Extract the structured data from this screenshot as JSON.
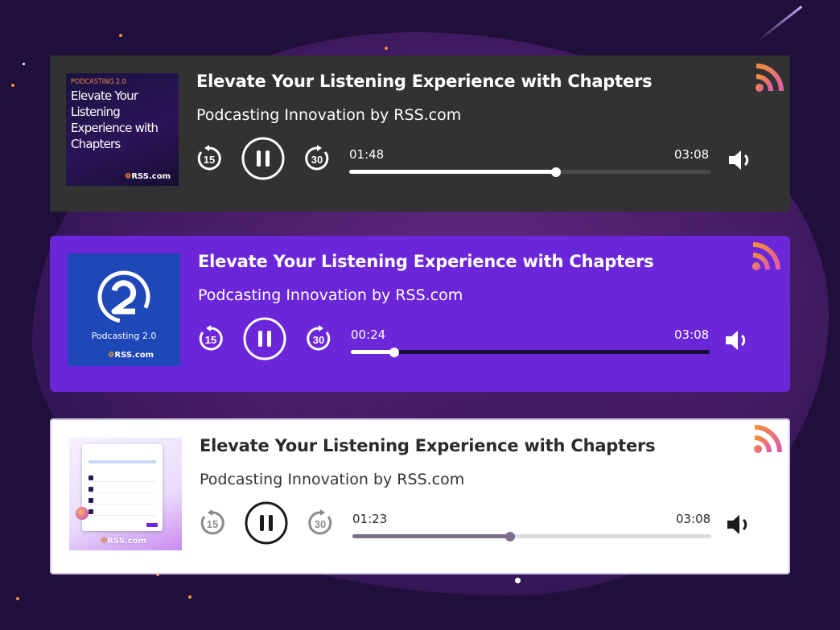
{
  "theme": {
    "accent_orange": "#f3903a",
    "dark_bg": "#323232",
    "purple_bg": "#6b26d9",
    "white_bg": "#ffffff",
    "page_bg": "#1f0f3a"
  },
  "players": [
    {
      "variant": "dark",
      "episode_title": "Elevate Your Listening Experience with Chapters",
      "show_name": "Podcasting Innovation by RSS.com",
      "current_time": "01:48",
      "duration": "03:08",
      "progress_fraction": 0.57,
      "skip_back_seconds": "15",
      "skip_forward_seconds": "30",
      "cover": {
        "tag": "PODCASTING 2.0",
        "headline": "Elevate Your Listening Experience with Chapters",
        "brand_prefix": "❁",
        "brand": "RSS.com"
      },
      "icons": [
        "rss-feed-icon",
        "skip-back-15-icon",
        "pause-icon",
        "skip-forward-30-icon",
        "volume-icon"
      ]
    },
    {
      "variant": "purple",
      "episode_title": "Elevate Your Listening Experience with Chapters",
      "show_name": "Podcasting Innovation by RSS.com",
      "current_time": "00:24",
      "duration": "03:08",
      "progress_fraction": 0.12,
      "skip_back_seconds": "15",
      "skip_forward_seconds": "30",
      "cover": {
        "name": "Podcasting 2.0",
        "brand": "RSS.com"
      },
      "icons": [
        "rss-feed-icon",
        "skip-back-15-icon",
        "pause-icon",
        "skip-forward-30-icon",
        "volume-icon"
      ]
    },
    {
      "variant": "white",
      "episode_title": "Elevate Your Listening Experience with Chapters",
      "show_name": "Podcasting Innovation by RSS.com",
      "current_time": "01:23",
      "duration": "03:08",
      "progress_fraction": 0.44,
      "skip_back_seconds": "15",
      "skip_forward_seconds": "30",
      "cover": {
        "brand": "RSS.com"
      },
      "icons": [
        "rss-feed-icon",
        "skip-back-15-icon",
        "pause-icon",
        "skip-forward-30-icon",
        "volume-icon"
      ]
    }
  ]
}
